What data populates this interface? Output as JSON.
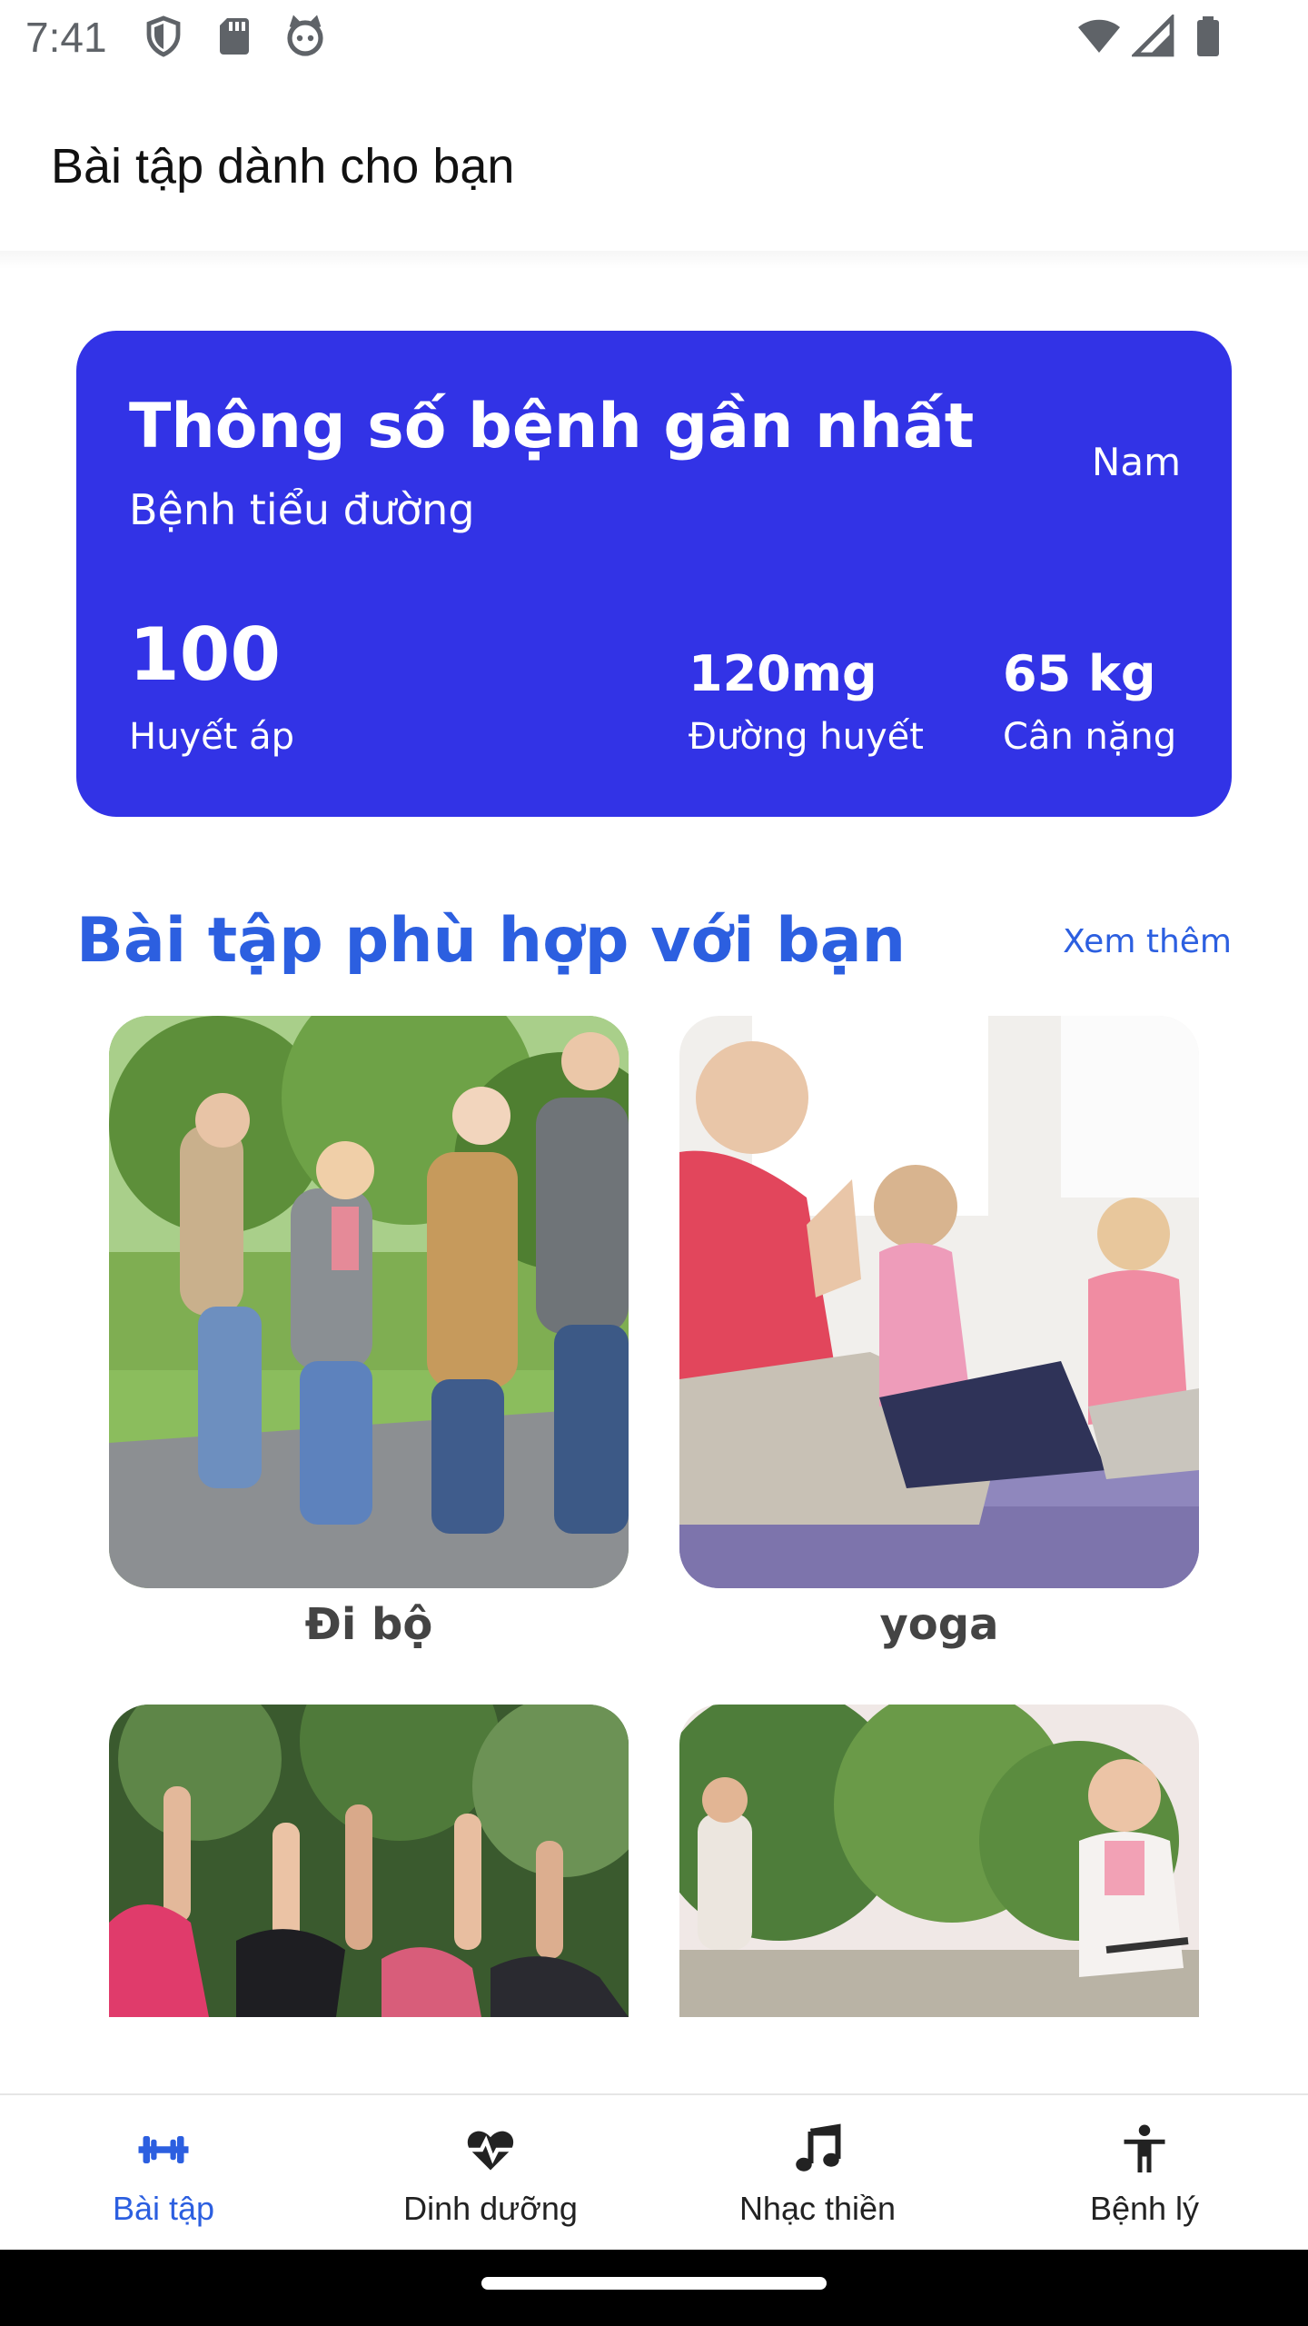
{
  "status_bar": {
    "time": "7:41",
    "icons": [
      "shield-icon",
      "sd-card-icon",
      "cat-face-icon",
      "wifi-icon",
      "cell-signal-icon",
      "battery-icon"
    ]
  },
  "app_bar": {
    "title": "Bài tập dành cho bạn"
  },
  "health_card": {
    "title": "Thông số bệnh gần nhất",
    "subtitle": "Bệnh tiểu đường",
    "gender": "Nam",
    "background_color": "#3233e6",
    "metrics": [
      {
        "value": "100",
        "label": "Huyết áp"
      },
      {
        "value": "120mg",
        "label": "Đường huyết"
      },
      {
        "value": "65 kg",
        "label": "Cân nặng"
      }
    ]
  },
  "section": {
    "title": "Bài tập phù hợp với bạn",
    "see_more": "Xem thêm",
    "accent_color": "#2c5fe0"
  },
  "exercises": [
    {
      "label": "Đi bộ",
      "image": "seniors-walking-park-photo"
    },
    {
      "label": "yoga",
      "image": "seniors-yoga-class-photo"
    },
    {
      "label": "",
      "image": "group-raised-hands-photo"
    },
    {
      "label": "",
      "image": "senior-cycling-park-photo"
    }
  ],
  "bottom_nav": {
    "items": [
      {
        "label": "Bài tập",
        "icon": "dumbbell-icon",
        "active": true
      },
      {
        "label": "Dinh dưỡng",
        "icon": "heartbeat-icon",
        "active": false
      },
      {
        "label": "Nhạc thiền",
        "icon": "music-note-icon",
        "active": false
      },
      {
        "label": "Bệnh lý",
        "icon": "accessibility-person-icon",
        "active": false
      }
    ]
  }
}
